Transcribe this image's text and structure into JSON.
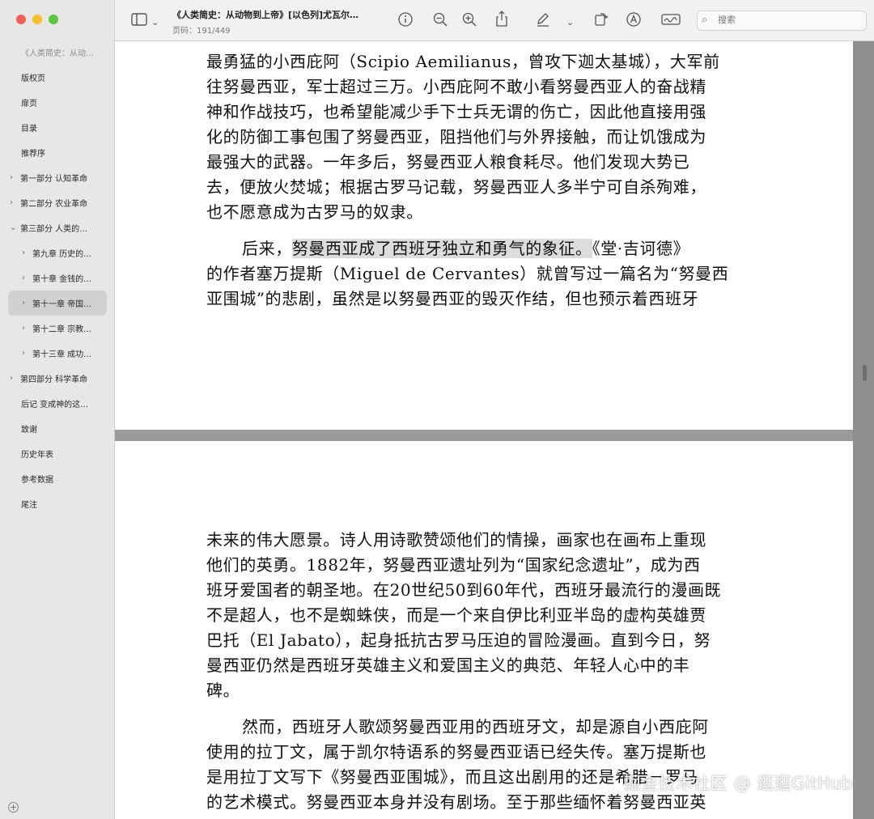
{
  "window": {
    "title": "《人类简史：从动物到上帝》[以色列]尤瓦尔…",
    "page_indicator": "页码：191/449"
  },
  "toolbar": {
    "search_placeholder": "搜索",
    "icons": [
      "sidebar-toggle-icon",
      "chevron-down-icon",
      "info-icon",
      "zoom-out-icon",
      "zoom-in-icon",
      "share-icon",
      "markup-pen-icon",
      "chevron-down-icon",
      "rotate-icon",
      "circled-a-icon",
      "signature-icon",
      "search-icon"
    ]
  },
  "sidebar": {
    "header": "《人类简史：从动…",
    "items": [
      {
        "label": "版权页",
        "kind": "noexp"
      },
      {
        "label": "扉页",
        "kind": "noexp"
      },
      {
        "label": "目录",
        "kind": "noexp"
      },
      {
        "label": "推荐序",
        "kind": "noexp"
      },
      {
        "label": "第一部分 认知革命",
        "kind": "top",
        "expand": "›"
      },
      {
        "label": "第二部分 农业革命",
        "kind": "top",
        "expand": "›"
      },
      {
        "label": "第三部分 人类的…",
        "kind": "top",
        "expand": "⌄"
      },
      {
        "label": "第九章 历史的…",
        "kind": "sub",
        "expand": "›"
      },
      {
        "label": "第十章 金钱的…",
        "kind": "sub",
        "expand": "›"
      },
      {
        "label": "第十一章 帝国…",
        "kind": "sub",
        "expand": "›",
        "active": true
      },
      {
        "label": "第十二章 宗教…",
        "kind": "sub",
        "expand": "›"
      },
      {
        "label": "第十三章 成功…",
        "kind": "sub",
        "expand": "›"
      },
      {
        "label": "第四部分 科学革命",
        "kind": "top",
        "expand": "›"
      },
      {
        "label": "后记 变成神的这…",
        "kind": "noexp"
      },
      {
        "label": "致谢",
        "kind": "noexp"
      },
      {
        "label": "历史年表",
        "kind": "noexp"
      },
      {
        "label": "参考数据",
        "kind": "noexp"
      },
      {
        "label": "尾注",
        "kind": "noexp"
      }
    ]
  },
  "page1": {
    "lines_para1": [
      "最勇猛的小西庇阿（Scipio Aemilianus，曾攻下迦太基城），大军前",
      "往努曼西亚，军士超过三万。小西庇阿不敢小看努曼西亚人的奋战精",
      "神和作战技巧，也希望能减少手下士兵无谓的伤亡，因此他直接用强",
      "化的防御工事包围了努曼西亚，阻挡他们与外界接触，而让饥饿成为",
      "最强大的武器。一年多后，努曼西亚人粮食耗尽。他们发现大势已",
      "去，便放火焚城；根据古罗马记载，努曼西亚人多半宁可自杀殉难，",
      "也不愿意成为古罗马的奴隶。"
    ],
    "para2_lead": "后来，",
    "para2_highlight": "努曼西亚成了西班牙独立和勇气的象征。",
    "para2_rest": "《堂·吉诃德》",
    "lines_para2": [
      "的作者塞万提斯（Miguel de Cervantes）就曾写过一篇名为“努曼西",
      "亚围城”的悲剧，虽然是以努曼西亚的毁灭作结，但也预示着西班牙"
    ]
  },
  "page2": {
    "lines_para1": [
      "未来的伟大愿景。诗人用诗歌赞颂他们的情操，画家也在画布上重现",
      "他们的英勇。1882年，努曼西亚遗址列为“国家纪念遗址”，成为西",
      "班牙爱国者的朝圣地。在20世纪50到60年代，西班牙最流行的漫画既",
      "不是超人，也不是蜘蛛侠，而是一个来自伊比利亚半岛的虚构英雄贾",
      "巴托（El Jabato），起身抵抗古罗马压迫的冒险漫画。直到今日，努",
      "曼西亚仍然是西班牙英雄主义和爱国主义的典范、年轻人心中的丰",
      "碑。"
    ],
    "lines_para2": [
      "然而，西班牙人歌颂努曼西亚用的西班牙文，却是源自小西庇阿",
      "使用的拉丁文，属于凯尔特语系的努曼西亚语已经失传。塞万提斯也",
      "是用拉丁文写下《努曼西亚围城》，而且这出剧用的还是希腊－罗马",
      "的艺术模式。努曼西亚本身并没有剧场。至于那些缅怀着努曼西亚英"
    ]
  },
  "watermark": "掘金技术社区 @ 逛逛GitHub"
}
